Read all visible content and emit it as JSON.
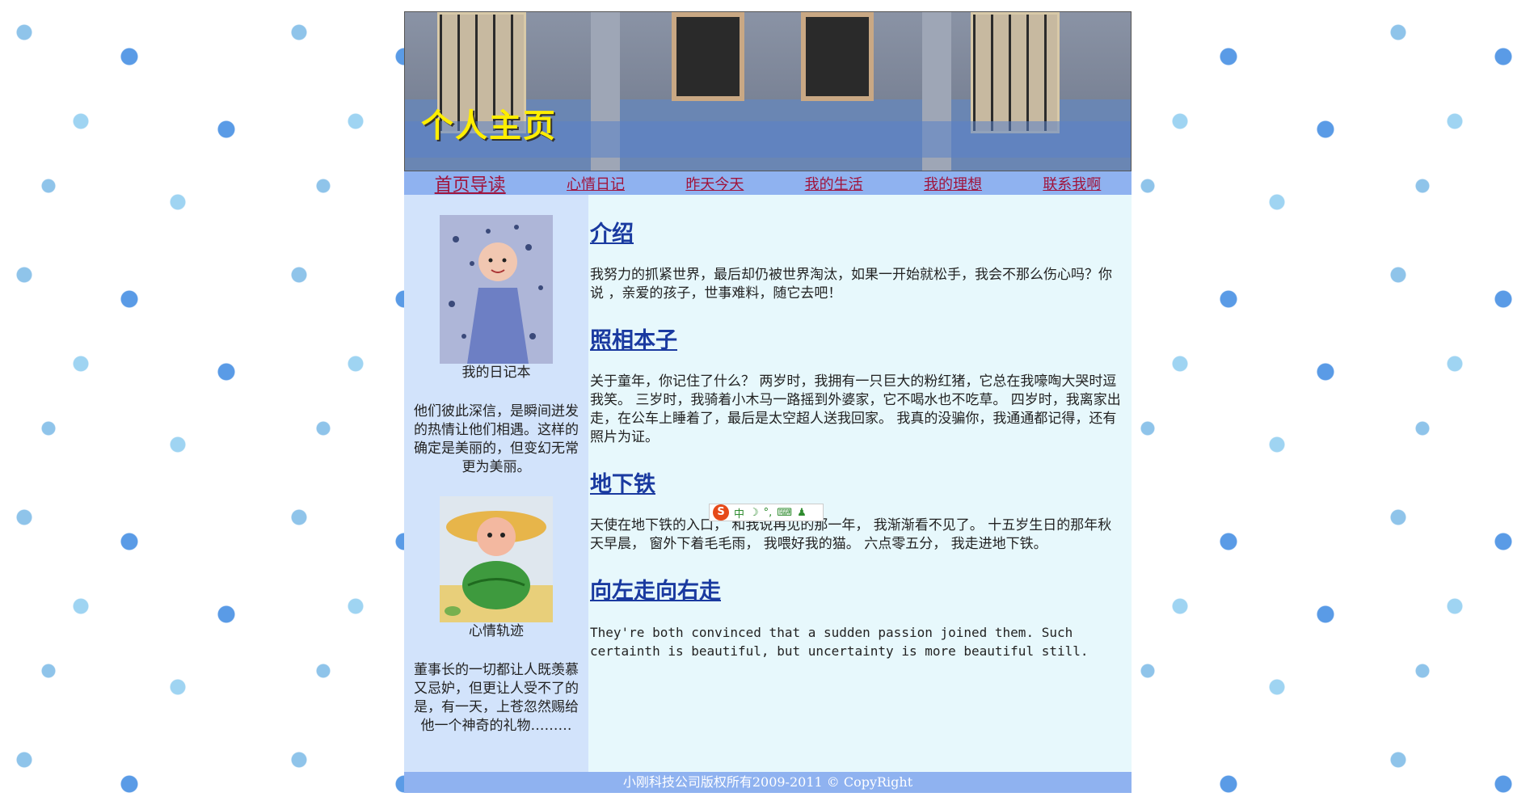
{
  "banner": {
    "title": "个人主页"
  },
  "nav": {
    "items": [
      {
        "label": "首页导读"
      },
      {
        "label": "心情日记"
      },
      {
        "label": "昨天今天"
      },
      {
        "label": "我的生活"
      },
      {
        "label": "我的理想"
      },
      {
        "label": "联系我啊"
      }
    ]
  },
  "sidebar": {
    "block1": {
      "caption": "我的日记本",
      "text": "他们彼此深信，是瞬间迸发的热情让他们相遇。这样的确定是美丽的，但变幻无常更为美丽。"
    },
    "block2": {
      "caption": "心情轨迹",
      "text": "董事长的一切都让人既羡慕又忌妒，但更让人受不了的是，有一天，上苍忽然赐给他一个神奇的礼物………"
    }
  },
  "main": {
    "sections": [
      {
        "heading": "介绍",
        "body": "我努力的抓紧世界，最后却仍被世界淘汰，如果一开始就松手，我会不那么伤心吗？你说 ，亲爱的孩子，世事难料，随它去吧！"
      },
      {
        "heading": "照相本子",
        "body": "关于童年，你记住了什么？ 两岁时，我拥有一只巨大的粉红猪，它总在我嚎啕大哭时逗我笑。 三岁时，我骑着小木马一路摇到外婆家，它不喝水也不吃草。 四岁时，我离家出走，在公车上睡着了，最后是太空超人送我回家。 我真的没骗你，我通通都记得，还有照片为证。"
      },
      {
        "heading": "地下铁",
        "body": "天使在地下铁的入口， 和我说再见的那一年， 我渐渐看不见了。 十五岁生日的那年秋天早晨， 窗外下着毛毛雨， 我喂好我的猫。 六点零五分， 我走进地下铁。"
      },
      {
        "heading": "向左走向右走",
        "body": "They're both convinced that a sudden passion joined them. Such certainth is beautiful, but uncertainty is more beautiful still."
      }
    ]
  },
  "footer": {
    "text": "小刚科技公司版权所有2009-2011 © CopyRight"
  },
  "ime_toolbar": {
    "label": "中"
  }
}
